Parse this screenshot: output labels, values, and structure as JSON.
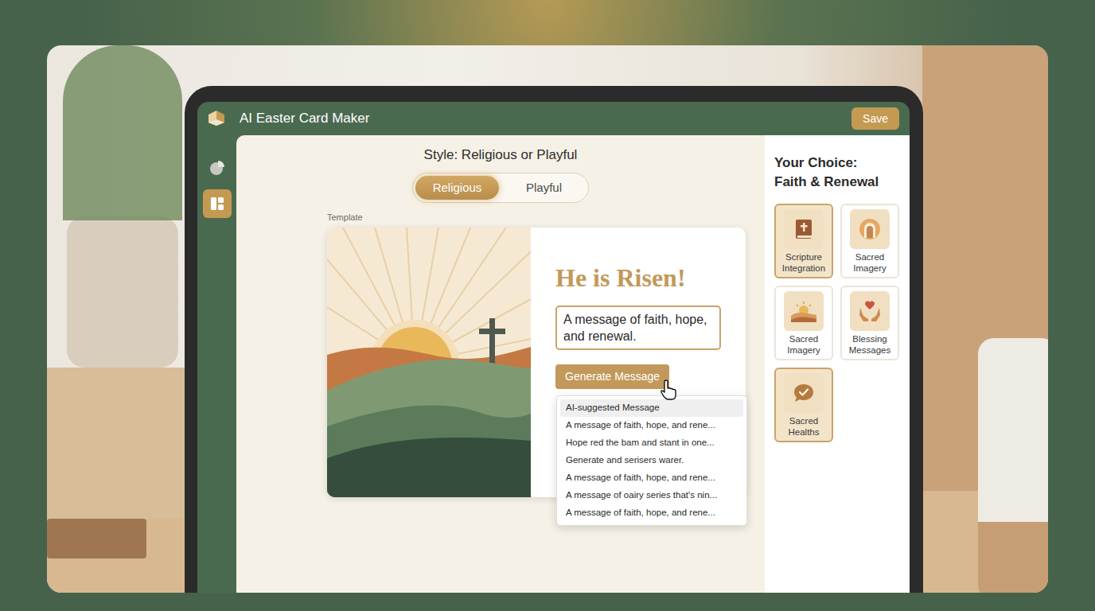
{
  "app": {
    "title": "AI Easter Card Maker",
    "save": "Save"
  },
  "sidebar": {
    "items": [
      {
        "selected": false
      },
      {
        "selected": true
      }
    ]
  },
  "style": {
    "label": "Style: Religious or Playful",
    "options": [
      {
        "label": "Religious",
        "selected": true
      },
      {
        "label": "Playful",
        "selected": false
      }
    ]
  },
  "template": {
    "label": "Template",
    "heading": "He is Risen!",
    "message": "A message of faith, hope, and renewal.",
    "button": "Generate Message"
  },
  "dropdown": {
    "items": [
      {
        "label": "AI-suggested Message",
        "selected": true
      },
      {
        "label": "A message of faith, hope, and rene...",
        "selected": false
      },
      {
        "label": "Hope red the bam and stant in one...",
        "selected": false
      },
      {
        "label": "Generate and serisers warer.",
        "selected": false
      },
      {
        "label": "A message of faith, hope, and rene...",
        "selected": false
      },
      {
        "label": "A message of oairy series that's nin...",
        "selected": false
      },
      {
        "label": "A message of faith, hope, and rene...",
        "selected": false
      }
    ]
  },
  "panel": {
    "title": [
      "Your Choice:",
      "Faith & Renewal"
    ],
    "choices": [
      {
        "label": "Scripture Integration",
        "selected": true
      },
      {
        "label": "Sacred Imagery",
        "selected": false
      },
      {
        "label": "Sacred Imagery",
        "selected": false
      },
      {
        "label": "Blessing Messages",
        "selected": false
      },
      {
        "label": "Sacred Healths",
        "selected": true
      }
    ]
  }
}
